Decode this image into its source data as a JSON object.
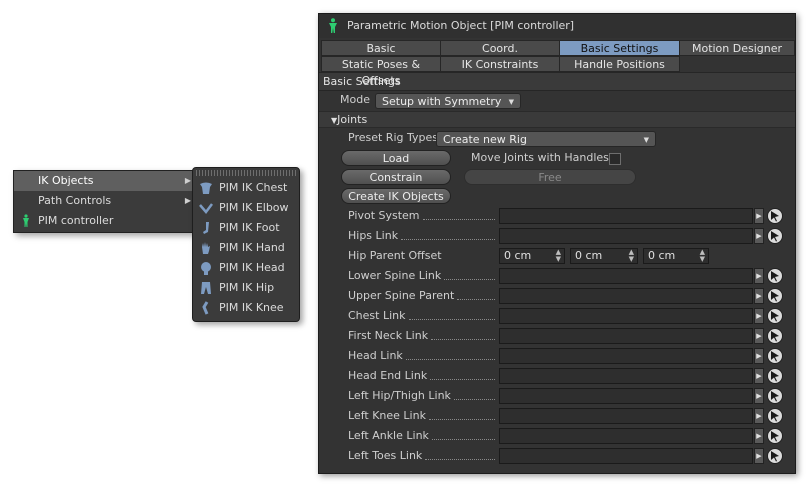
{
  "context_menu": {
    "items": [
      {
        "label": "IK Objects",
        "active": true
      },
      {
        "label": "Path Controls",
        "active": false
      },
      {
        "label": "PIM controller",
        "active": false
      }
    ],
    "submenu": [
      {
        "label": "PIM IK Chest",
        "icon": "chest-icon"
      },
      {
        "label": "PIM IK Elbow",
        "icon": "elbow-icon"
      },
      {
        "label": "PIM IK Foot",
        "icon": "foot-icon"
      },
      {
        "label": "PIM IK Hand",
        "icon": "hand-icon"
      },
      {
        "label": "PIM IK Head",
        "icon": "head-icon"
      },
      {
        "label": "PIM IK Hip",
        "icon": "hip-icon"
      },
      {
        "label": "PIM IK Knee",
        "icon": "knee-icon"
      }
    ]
  },
  "window": {
    "title": "Parametric Motion Object [PIM controller]",
    "tabs_row1": [
      "Basic",
      "Coord.",
      "Basic Settings",
      "Motion Designer"
    ],
    "tabs_row2": [
      "Static Poses & Offsets",
      "IK Constraints",
      "Handle Positions"
    ],
    "selected_tab": "Basic Settings",
    "section_title": "Basic Settings",
    "mode": {
      "label": "Mode",
      "value": "Setup with Symmetry"
    },
    "group_title": "Joints",
    "preset": {
      "label": "Preset Rig Types",
      "value": "Create new Rig"
    },
    "buttons": {
      "load": "Load",
      "constrain": "Constrain",
      "free": "Free",
      "create_ik": "Create IK Objects"
    },
    "move_joints": {
      "label": "Move Joints with Handles",
      "checked": false
    },
    "hip_offset": {
      "label": "Hip Parent Offset",
      "values": [
        "0 cm",
        "0 cm",
        "0 cm"
      ]
    },
    "links": [
      "Pivot System",
      "Hips Link",
      "Lower Spine Link",
      "Upper Spine Parent",
      "Chest Link",
      "First Neck Link",
      "Head Link",
      "Head End Link",
      "Left Hip/Thigh Link",
      "Left Knee Link",
      "Left Ankle Link",
      "Left Toes Link"
    ]
  },
  "colors": {
    "accent_tab": "#7d9bc1",
    "panel_bg": "#333333",
    "figure_green": "#2ecc71"
  }
}
